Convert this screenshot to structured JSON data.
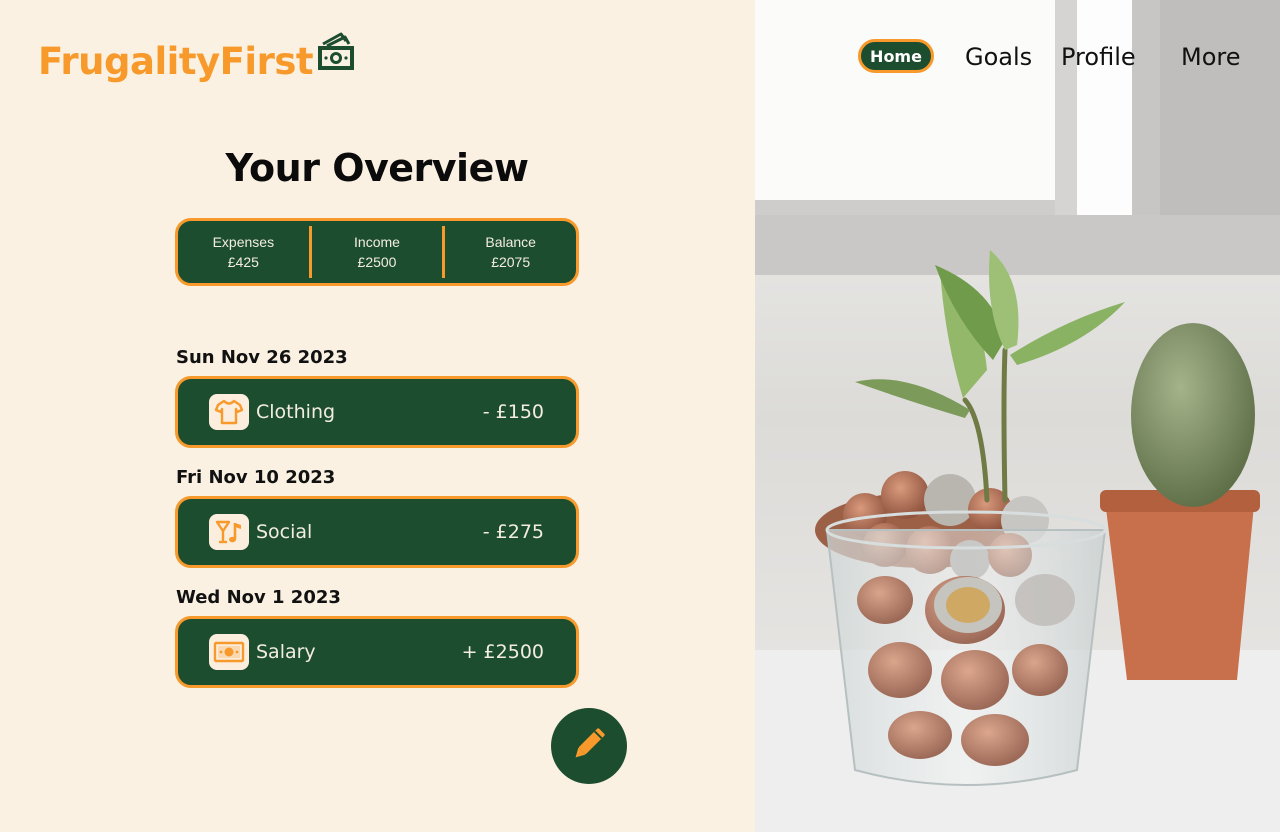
{
  "brand": {
    "name": "FrugalityFirst",
    "icon": "money-bills-icon"
  },
  "nav": {
    "items": [
      {
        "label": "Home",
        "active": true
      },
      {
        "label": "Goals",
        "active": false
      },
      {
        "label": "Profile",
        "active": false
      },
      {
        "label": "More",
        "active": false
      }
    ]
  },
  "overview": {
    "title": "Your Overview",
    "summary": [
      {
        "label": "Expenses",
        "value": "£425"
      },
      {
        "label": "Income",
        "value": "£2500"
      },
      {
        "label": "Balance",
        "value": "£2075"
      }
    ]
  },
  "transactions": [
    {
      "date": "Sun Nov 26 2023",
      "category": "Clothing",
      "amount": "- £150",
      "icon": "tshirt-icon"
    },
    {
      "date": "Fri Nov 10 2023",
      "category": "Social",
      "amount": "- £275",
      "icon": "cocktail-music-icon"
    },
    {
      "date": "Wed Nov 1 2023",
      "category": "Salary",
      "amount": "+ £2500",
      "icon": "banknote-icon"
    }
  ],
  "actions": {
    "edit_icon": "pencil-icon"
  },
  "colors": {
    "background": "#faf1e2",
    "primary_green": "#1d4d2f",
    "accent_orange": "#f79a2b",
    "card_text": "#f3ede0"
  }
}
